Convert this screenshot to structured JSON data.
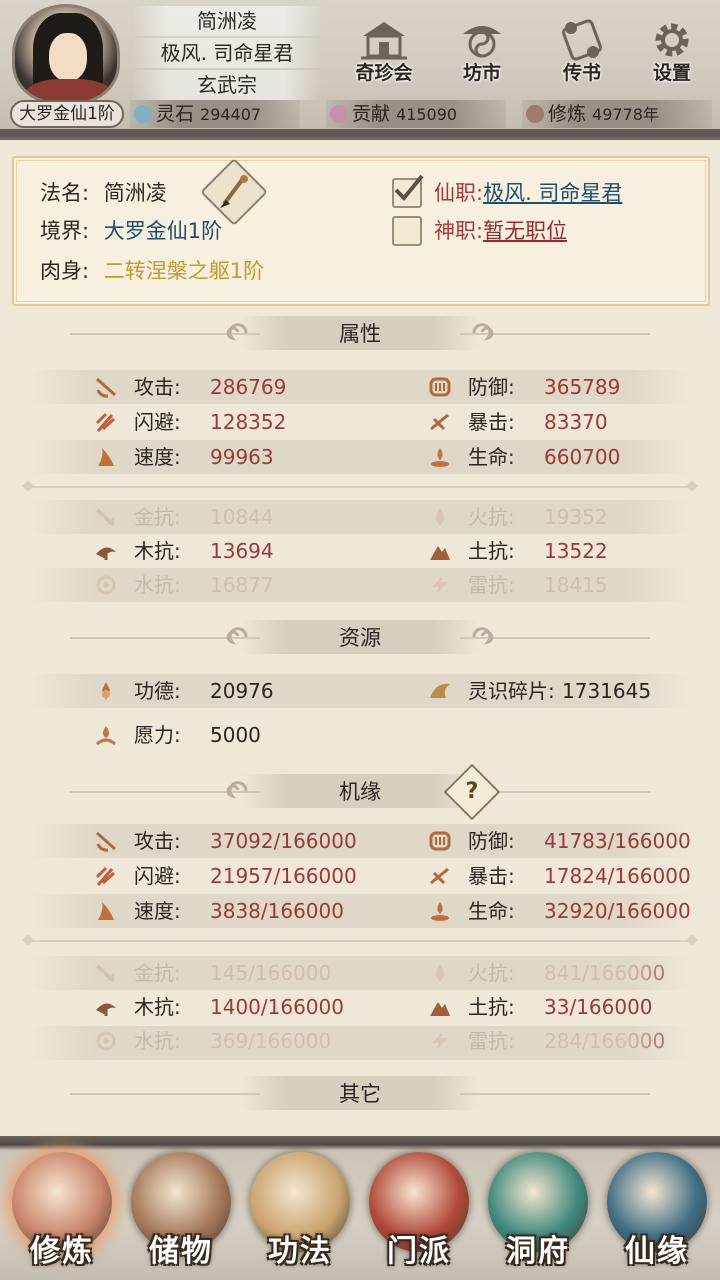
{
  "header": {
    "realm_badge": "大罗金仙1阶",
    "name": "简洲凌",
    "title": "极风. 司命星君",
    "sect": "玄武宗",
    "buttons": [
      {
        "label": "奇珍会",
        "icon": "treasure-pavilion-icon"
      },
      {
        "label": "坊市",
        "icon": "market-icon"
      },
      {
        "label": "传书",
        "icon": "scroll-letter-icon"
      },
      {
        "label": "设置",
        "icon": "gear-icon"
      }
    ],
    "resources": [
      {
        "name": "灵石",
        "value": "294407",
        "icon": "spirit-stone-icon",
        "color": "#7fb0c8"
      },
      {
        "name": "贡献",
        "value": "415090",
        "icon": "contribution-icon",
        "color": "#c98fa6"
      },
      {
        "name": "修炼",
        "value": "49778年",
        "icon": "cultivation-icon",
        "color": "#a07a6a"
      }
    ]
  },
  "profile": {
    "dharma_name_key": "法名:",
    "dharma_name": "简洲凌",
    "realm_key": "境界:",
    "realm": "大罗金仙1阶",
    "body_key": "肉身:",
    "body": "二转涅槃之躯1阶",
    "immortal_post_key": "仙职:",
    "immortal_post": "极风. 司命星君",
    "immortal_post_checked": true,
    "divine_post_key": "神职:",
    "divine_post": "暂无职位",
    "divine_post_checked": false
  },
  "attributes": {
    "title": "属性",
    "rows": [
      [
        {
          "k": "攻击:",
          "v": "286769",
          "icon": "attack-icon"
        },
        {
          "k": "防御:",
          "v": "365789",
          "icon": "defense-icon"
        }
      ],
      [
        {
          "k": "闪避:",
          "v": "128352",
          "icon": "dodge-icon"
        },
        {
          "k": "暴击:",
          "v": "83370",
          "icon": "crit-icon"
        }
      ],
      [
        {
          "k": "速度:",
          "v": "99963",
          "icon": "speed-icon"
        },
        {
          "k": "生命:",
          "v": "660700",
          "icon": "life-icon"
        }
      ]
    ],
    "resist_rows": [
      [
        {
          "k": "金抗:",
          "v": "10844",
          "icon": "metal-resist-icon"
        },
        {
          "k": "火抗:",
          "v": "19352",
          "icon": "fire-resist-icon"
        }
      ],
      [
        {
          "k": "木抗:",
          "v": "13694",
          "icon": "wood-resist-icon"
        },
        {
          "k": "土抗:",
          "v": "13522",
          "icon": "earth-resist-icon"
        }
      ],
      [
        {
          "k": "水抗:",
          "v": "16877",
          "icon": "water-resist-icon"
        },
        {
          "k": "雷抗:",
          "v": "18415",
          "icon": "thunder-resist-icon"
        }
      ]
    ]
  },
  "resources_section": {
    "title": "资源",
    "merit_key": "功德:",
    "merit": "20976",
    "fragments_key": "灵识碎片:",
    "fragments": "1731645",
    "wish_key": "愿力:",
    "wish": "5000"
  },
  "fortune": {
    "title": "机缘",
    "help": "?",
    "rows": [
      [
        {
          "k": "攻击:",
          "v": "37092/166000",
          "icon": "attack-icon"
        },
        {
          "k": "防御:",
          "v": "41783/166000",
          "icon": "defense-icon"
        }
      ],
      [
        {
          "k": "闪避:",
          "v": "21957/166000",
          "icon": "dodge-icon"
        },
        {
          "k": "暴击:",
          "v": "17824/166000",
          "icon": "crit-icon"
        }
      ],
      [
        {
          "k": "速度:",
          "v": "3838/166000",
          "icon": "speed-icon"
        },
        {
          "k": "生命:",
          "v": "32920/166000",
          "icon": "life-icon"
        }
      ]
    ],
    "resist_rows": [
      [
        {
          "k": "金抗:",
          "v": "145/166000",
          "icon": "metal-resist-icon"
        },
        {
          "k": "火抗:",
          "v": "841/166000",
          "icon": "fire-resist-icon"
        }
      ],
      [
        {
          "k": "木抗:",
          "v": "1400/166000",
          "icon": "wood-resist-icon"
        },
        {
          "k": "土抗:",
          "v": "33/166000",
          "icon": "earth-resist-icon"
        }
      ],
      [
        {
          "k": "水抗:",
          "v": "369/166000",
          "icon": "water-resist-icon"
        },
        {
          "k": "雷抗:",
          "v": "284/166000",
          "icon": "thunder-resist-icon"
        }
      ]
    ]
  },
  "other": {
    "title": "其它"
  },
  "bottom_nav": [
    {
      "label": "修炼",
      "icon": "cultivation-master-icon",
      "color": "#c9856a",
      "active": true
    },
    {
      "label": "储物",
      "icon": "storage-bag-icon",
      "color": "#a5795a",
      "active": false
    },
    {
      "label": "功法",
      "icon": "technique-scroll-icon",
      "color": "#c9a470",
      "active": false
    },
    {
      "label": "门派",
      "icon": "sect-gate-icon",
      "color": "#b24a3a",
      "active": false
    },
    {
      "label": "洞府",
      "icon": "cave-dwelling-icon",
      "color": "#3f8a7c",
      "active": false
    },
    {
      "label": "仙缘",
      "icon": "immortal-fate-icon",
      "color": "#3f6f86",
      "active": false
    }
  ]
}
